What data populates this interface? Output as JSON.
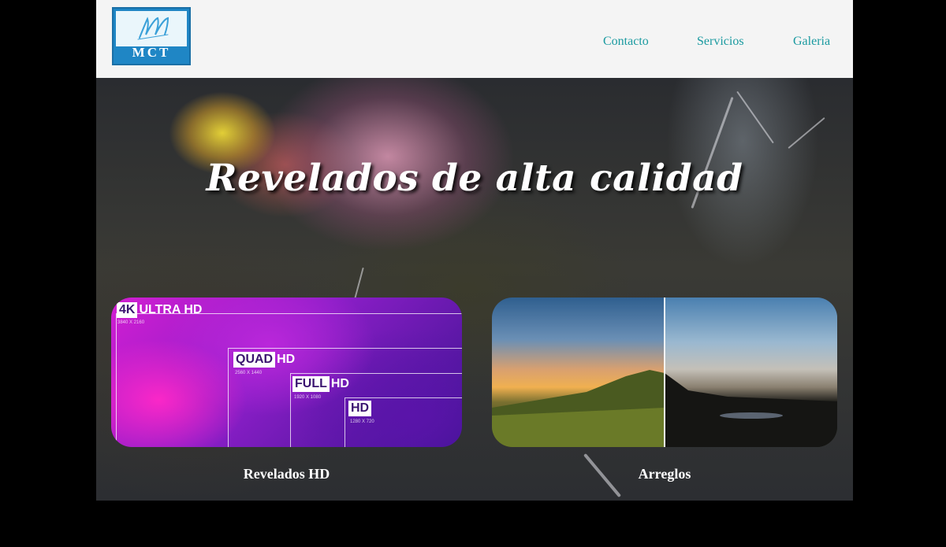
{
  "header": {
    "logo": {
      "text": "MCT",
      "script_mark": "m"
    },
    "nav": [
      {
        "label": "Contacto"
      },
      {
        "label": "Servicios"
      },
      {
        "label": "Galeria"
      }
    ]
  },
  "hero": {
    "title": "Revelados de alta calidad"
  },
  "cards": [
    {
      "label": "Revelados HD",
      "image": {
        "badges": [
          {
            "strong": "4K",
            "text": "ULTRA HD",
            "res": "3840 X 2160"
          },
          {
            "strong": "QUAD",
            "text": "HD",
            "res": "2560 X 1440"
          },
          {
            "strong": "FULL",
            "text": "HD",
            "res": "1920 X 1080"
          },
          {
            "strong": "HD",
            "text": "",
            "res": "1280 X 720"
          }
        ]
      }
    },
    {
      "label": "Arreglos"
    }
  ],
  "colors": {
    "nav_link": "#1a9aa0",
    "logo_blue": "#1f86c5",
    "header_bg": "#f4f4f4",
    "page_bg": "#000000"
  }
}
